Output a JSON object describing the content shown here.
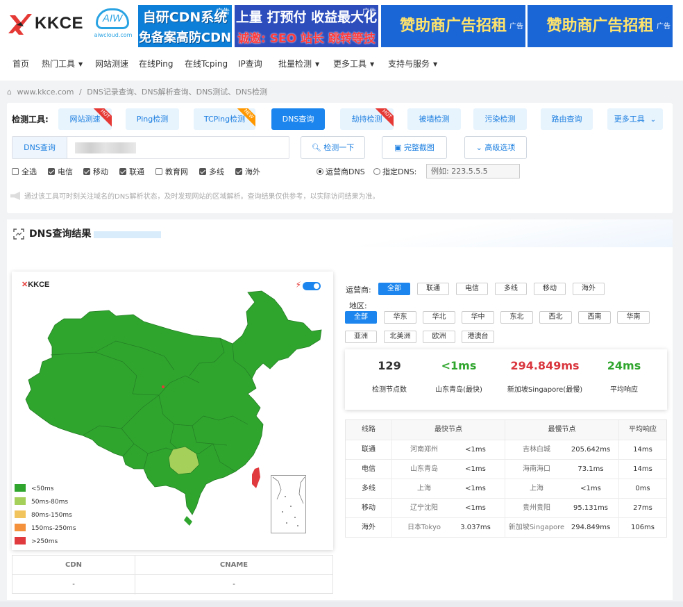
{
  "header": {
    "logo_text": "KKCE",
    "partner_logo": {
      "name": "AIW",
      "domain": "aiwcloud.com"
    },
    "ads": [
      {
        "tag": "广告",
        "line1": "自研CDN系统",
        "line2": "免备案高防CDN"
      },
      {
        "tag": "广告",
        "line1": "上量 打预付 收益最大化",
        "line2": "诚邀: SEO 站长 跳转等技术合作"
      },
      {
        "tag": "广告",
        "line1": "赞助商广告招租"
      },
      {
        "tag": "广告",
        "line1": "赞助商广告招租"
      }
    ]
  },
  "nav": [
    {
      "label": "首页",
      "dropdown": false
    },
    {
      "label": "热门工具",
      "dropdown": true
    },
    {
      "label": "网站测速",
      "dropdown": false
    },
    {
      "label": "在线Ping",
      "dropdown": false
    },
    {
      "label": "在线Tcping",
      "dropdown": false
    },
    {
      "label": "IP查询",
      "dropdown": false
    },
    {
      "label": "批量检测",
      "dropdown": true
    },
    {
      "label": "更多工具",
      "dropdown": true
    },
    {
      "label": "支持与服务",
      "dropdown": true
    }
  ],
  "breadcrumb": {
    "site": "www.kkce.com",
    "sep": "/",
    "page": "DNS记录查询、DNS解析查询、DNS测试、DNS检测"
  },
  "tools": {
    "label": "检测工具:",
    "items": [
      {
        "label": "网站测速",
        "badge": "HOT",
        "active": false
      },
      {
        "label": "Ping检测",
        "badge": "",
        "active": false
      },
      {
        "label": "TCPing检测",
        "badge": "NEW",
        "active": false
      },
      {
        "label": "DNS查询",
        "badge": "",
        "active": true
      },
      {
        "label": "劫持检测",
        "badge": "HOT",
        "active": false
      },
      {
        "label": "被墙检测",
        "badge": "",
        "active": false
      },
      {
        "label": "污染检测",
        "badge": "",
        "active": false
      },
      {
        "label": "路由查询",
        "badge": "",
        "active": false
      },
      {
        "label": "更多工具",
        "badge": "",
        "active": false
      }
    ]
  },
  "query": {
    "prefix": "DNS查询",
    "check_button": "检测一下",
    "screenshot_button": "完整截图",
    "advanced_button": "高级选项",
    "checkboxes": [
      {
        "label": "全选",
        "checked": false
      },
      {
        "label": "电信",
        "checked": true
      },
      {
        "label": "移动",
        "checked": true
      },
      {
        "label": "联通",
        "checked": true
      },
      {
        "label": "教育网",
        "checked": false
      },
      {
        "label": "多线",
        "checked": true
      },
      {
        "label": "海外",
        "checked": true
      }
    ],
    "radios": [
      {
        "label": "运营商DNS",
        "selected": true
      },
      {
        "label": "指定DNS:",
        "selected": false
      }
    ],
    "dns_placeholder": "例如: 223.5.5.5",
    "notice": "通过该工具可时刻关注域名的DNS解析状态，及时发现网站的区域解析。查询结果仅供参考，以实际访问结果为准。"
  },
  "result": {
    "title": "DNS查询结果",
    "map_logo": "KKCE",
    "legend": [
      {
        "label": "<50ms",
        "color": "#2fa52e"
      },
      {
        "label": "50ms-80ms",
        "color": "#a5d05a"
      },
      {
        "label": "80ms-150ms",
        "color": "#f2c45e"
      },
      {
        "label": "150ms-250ms",
        "color": "#f3913c"
      },
      {
        "label": ">250ms",
        "color": "#e0393e"
      }
    ],
    "cdn_table": {
      "headers": [
        "CDN",
        "CNAME"
      ],
      "values": [
        "-",
        "-"
      ]
    },
    "operator_label": "运营商:",
    "operators": [
      {
        "label": "全部",
        "active": true
      },
      {
        "label": "联通",
        "active": false
      },
      {
        "label": "电信",
        "active": false
      },
      {
        "label": "多线",
        "active": false
      },
      {
        "label": "移动",
        "active": false
      },
      {
        "label": "海外",
        "active": false
      }
    ],
    "region_label": "地区:",
    "regions": [
      {
        "label": "全部",
        "active": true
      },
      {
        "label": "华东",
        "active": false
      },
      {
        "label": "华北",
        "active": false
      },
      {
        "label": "华中",
        "active": false
      },
      {
        "label": "东北",
        "active": false
      },
      {
        "label": "西北",
        "active": false
      },
      {
        "label": "西南",
        "active": false
      },
      {
        "label": "华南",
        "active": false
      },
      {
        "label": "亚洲",
        "active": false
      },
      {
        "label": "北美洲",
        "active": false
      },
      {
        "label": "欧洲",
        "active": false
      },
      {
        "label": "港澳台",
        "active": false
      }
    ],
    "stats": [
      {
        "value": "129",
        "label": "检测节点数",
        "color": "#333333"
      },
      {
        "value": "<1ms",
        "label": "山东青岛(最快)",
        "color": "#2fa52e"
      },
      {
        "value": "294.849ms",
        "label": "新加坡Singapore(最慢)",
        "color": "#d9363e"
      },
      {
        "value": "24ms",
        "label": "平均响应",
        "color": "#2fa52e"
      }
    ],
    "table": {
      "headers": [
        "线路",
        "最快节点",
        "最慢节点",
        "平均响应"
      ],
      "rows": [
        {
          "line": "联通",
          "fast_node": "河南郑州",
          "fast_time": "<1ms",
          "slow_node": "吉林白城",
          "slow_time": "205.642ms",
          "avg": "14ms"
        },
        {
          "line": "电信",
          "fast_node": "山东青岛",
          "fast_time": "<1ms",
          "slow_node": "海南海口",
          "slow_time": "73.1ms",
          "avg": "14ms"
        },
        {
          "line": "多线",
          "fast_node": "上海",
          "fast_time": "<1ms",
          "slow_node": "上海",
          "slow_time": "<1ms",
          "avg": "0ms"
        },
        {
          "line": "移动",
          "fast_node": "辽宁沈阳",
          "fast_time": "<1ms",
          "slow_node": "贵州贵阳",
          "slow_time": "95.131ms",
          "avg": "27ms"
        },
        {
          "line": "海外",
          "fast_node": "日本Tokyo",
          "fast_time": "3.037ms",
          "slow_node": "新加坡Singapore",
          "slow_time": "294.849ms",
          "avg": "106ms"
        }
      ]
    }
  }
}
